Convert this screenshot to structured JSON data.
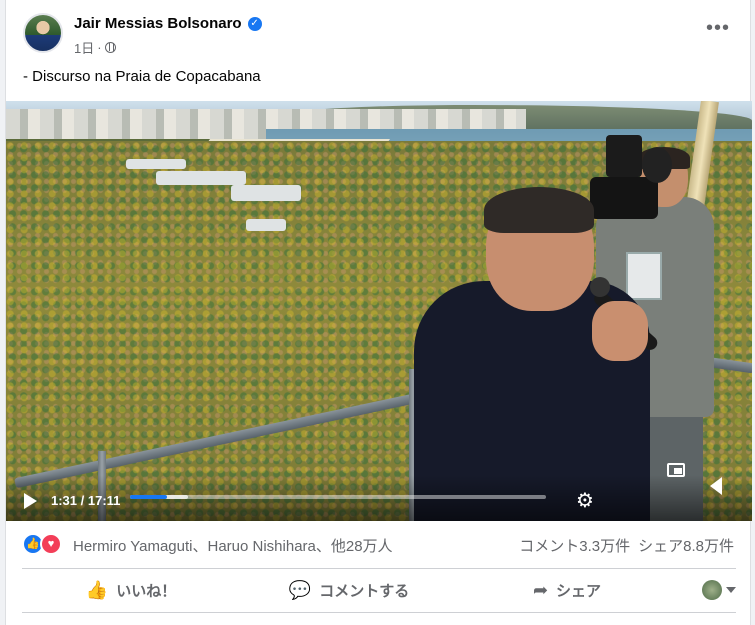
{
  "post": {
    "author": "Jair Messias Bolsonaro",
    "time": "1日",
    "separator": "·",
    "caption": "- Discurso na Praia de Copacabana",
    "more": "•••"
  },
  "video": {
    "time_display": "1:31 / 17:11",
    "progress": 0.088,
    "buffered": 0.14
  },
  "stats": {
    "reactors": "Hermiro Yamaguti、Haruo Nishihara、他28万人",
    "comments": "コメント3.3万件",
    "shares": "シェア8.8万件"
  },
  "actions": {
    "like": "いいね！",
    "comment": "コメントする",
    "share": "シェア"
  },
  "colors": {
    "accent": "#1877f2",
    "love": "#f33e58"
  }
}
